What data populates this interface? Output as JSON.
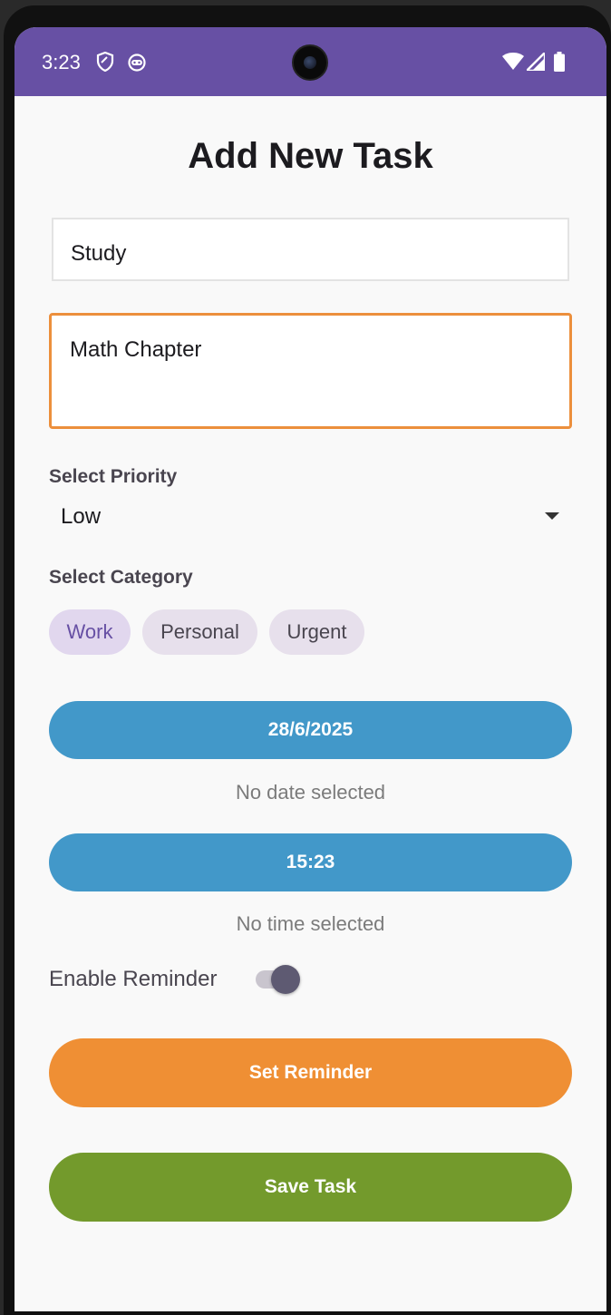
{
  "status_bar": {
    "time": "3:23",
    "left_icons": [
      "shield-icon",
      "android-head-icon"
    ],
    "right_icons": [
      "wifi-icon",
      "cell-signal-icon",
      "battery-icon"
    ],
    "color": "#6750a4"
  },
  "form": {
    "title": "Add New Task",
    "task_title_value": "Study",
    "task_description_value": "Math Chapter",
    "priority": {
      "label": "Select Priority",
      "selected": "Low"
    },
    "category": {
      "label": "Select Category",
      "chips": [
        {
          "label": "Work",
          "selected": true
        },
        {
          "label": "Personal",
          "selected": false
        },
        {
          "label": "Urgent",
          "selected": false
        }
      ]
    },
    "date": {
      "button_label": "28/6/2025",
      "helper": "No date selected"
    },
    "time": {
      "button_label": "15:23",
      "helper": "No time selected"
    },
    "reminder": {
      "label": "Enable Reminder",
      "enabled": true
    },
    "set_reminder_label": "Set Reminder",
    "save_task_label": "Save Task"
  },
  "colors": {
    "accent_purple": "#6750a4",
    "focus_orange": "#ec8f3c",
    "date_time_blue": "#4298c9",
    "reminder_orange": "#ef8f34",
    "save_green": "#739a2c"
  }
}
